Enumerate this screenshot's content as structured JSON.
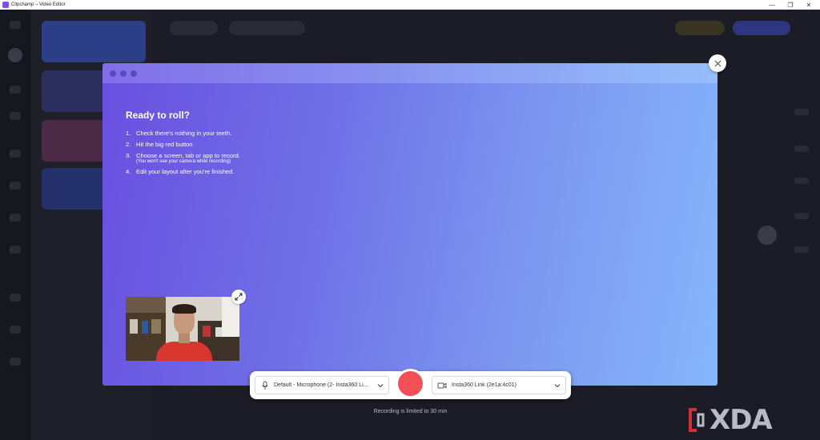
{
  "window": {
    "title": "Clipchamp – Video Editor",
    "controls": {
      "minimize": "—",
      "maximize": "❐",
      "close": "✕"
    }
  },
  "modal": {
    "heading": "Ready to roll?",
    "steps": [
      {
        "num": "1.",
        "text": "Check there's nothing in your teeth."
      },
      {
        "num": "2.",
        "text": "Hit the big red button."
      },
      {
        "num": "3.",
        "text": "Choose a screen, tab or app to record."
      },
      {
        "num": "4.",
        "text": "Edit your layout after you're finished."
      }
    ],
    "step3_note": "(You won't see your camera while recording)",
    "close_icon": "close-icon",
    "expand_icon": "expand-icon"
  },
  "recorder": {
    "microphone": {
      "icon": "microphone-icon",
      "value": "Default - Microphone (2- Insta360 Li..."
    },
    "camera": {
      "icon": "camera-icon",
      "value": "Insta360 Link (2e1a:4c01)"
    },
    "record_color": "#f24f56",
    "limit_note": "Recording is limited to 30 min"
  },
  "watermark": {
    "text": "XDA",
    "accent": "#d1303a"
  }
}
